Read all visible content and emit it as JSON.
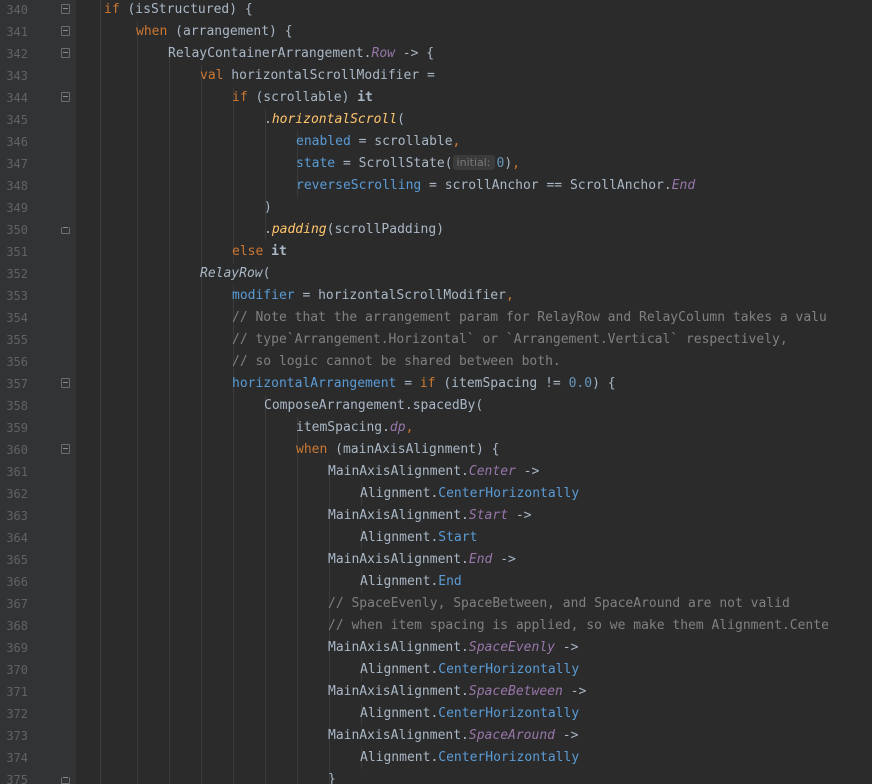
{
  "editor": {
    "lines": [
      {
        "n": "340",
        "indent": 1,
        "fold": "start",
        "tokens": [
          [
            "kw",
            "if"
          ],
          [
            "t",
            " (isStructured) {"
          ]
        ]
      },
      {
        "n": "341",
        "indent": 2,
        "fold": "start",
        "tokens": [
          [
            "kw",
            "when"
          ],
          [
            "t",
            " (arrangement) {"
          ]
        ]
      },
      {
        "n": "342",
        "indent": 3,
        "fold": "start",
        "tokens": [
          [
            "t",
            "RelayContainerArrangement."
          ],
          [
            "prop",
            "Row"
          ],
          [
            "t",
            " -> {"
          ]
        ]
      },
      {
        "n": "343",
        "indent": 4,
        "fold": "",
        "tokens": [
          [
            "kw",
            "val"
          ],
          [
            "t",
            " horizontalScrollModifier ="
          ]
        ]
      },
      {
        "n": "344",
        "indent": 5,
        "fold": "start",
        "tokens": [
          [
            "kw",
            "if"
          ],
          [
            "t",
            " (scrollable) "
          ],
          [
            "b",
            "it"
          ]
        ]
      },
      {
        "n": "345",
        "indent": 6,
        "fold": "",
        "tokens": [
          [
            "t",
            "."
          ],
          [
            "fn",
            "horizontalScroll"
          ],
          [
            "t",
            "("
          ]
        ]
      },
      {
        "n": "346",
        "indent": 7,
        "fold": "",
        "tokens": [
          [
            "param",
            "enabled"
          ],
          [
            "t",
            " = scrollable"
          ],
          [
            "punc",
            ","
          ]
        ]
      },
      {
        "n": "347",
        "indent": 7,
        "fold": "",
        "tokens": [
          [
            "param",
            "state"
          ],
          [
            "t",
            " = ScrollState("
          ],
          [
            "hint",
            "initial:"
          ],
          [
            "num",
            "0"
          ],
          [
            "t",
            ")"
          ],
          [
            "punc",
            ","
          ]
        ]
      },
      {
        "n": "348",
        "indent": 7,
        "fold": "",
        "tokens": [
          [
            "param",
            "reverseScrolling"
          ],
          [
            "t",
            " = scrollAnchor == ScrollAnchor."
          ],
          [
            "prop",
            "End"
          ]
        ]
      },
      {
        "n": "349",
        "indent": 6,
        "fold": "",
        "tokens": [
          [
            "t",
            ")"
          ]
        ]
      },
      {
        "n": "350",
        "indent": 6,
        "fold": "end",
        "tokens": [
          [
            "t",
            "."
          ],
          [
            "fn",
            "padding"
          ],
          [
            "t",
            "(scrollPadding)"
          ]
        ]
      },
      {
        "n": "351",
        "indent": 5,
        "fold": "",
        "tokens": [
          [
            "kw",
            "else"
          ],
          [
            "t",
            " "
          ],
          [
            "b",
            "it"
          ]
        ]
      },
      {
        "n": "352",
        "indent": 4,
        "fold": "",
        "tokens": [
          [
            "fi",
            "RelayRow"
          ],
          [
            "t",
            "("
          ]
        ]
      },
      {
        "n": "353",
        "indent": 5,
        "fold": "",
        "tokens": [
          [
            "param",
            "modifier"
          ],
          [
            "t",
            " = horizontalScrollModifier"
          ],
          [
            "punc",
            ","
          ]
        ]
      },
      {
        "n": "354",
        "indent": 5,
        "fold": "",
        "tokens": [
          [
            "cm",
            "// Note that the arrangement param for RelayRow and RelayColumn takes a valu"
          ]
        ]
      },
      {
        "n": "355",
        "indent": 5,
        "fold": "",
        "tokens": [
          [
            "cm",
            "// type`Arrangement.Horizontal` or `Arrangement.Vertical` respectively,"
          ]
        ]
      },
      {
        "n": "356",
        "indent": 5,
        "fold": "",
        "tokens": [
          [
            "cm",
            "// so logic cannot be shared between both."
          ]
        ]
      },
      {
        "n": "357",
        "indent": 5,
        "fold": "start",
        "tokens": [
          [
            "param",
            "horizontalArrangement"
          ],
          [
            "t",
            " = "
          ],
          [
            "kw",
            "if"
          ],
          [
            "t",
            " (itemSpacing != "
          ],
          [
            "num",
            "0.0"
          ],
          [
            "t",
            ") {"
          ]
        ]
      },
      {
        "n": "358",
        "indent": 6,
        "fold": "",
        "tokens": [
          [
            "t",
            "ComposeArrangement.spacedBy("
          ]
        ]
      },
      {
        "n": "359",
        "indent": 7,
        "fold": "",
        "tokens": [
          [
            "t",
            "itemSpacing."
          ],
          [
            "prop",
            "dp"
          ],
          [
            "punc",
            ","
          ]
        ]
      },
      {
        "n": "360",
        "indent": 7,
        "fold": "start",
        "tokens": [
          [
            "kw",
            "when"
          ],
          [
            "t",
            " (mainAxisAlignment) {"
          ]
        ]
      },
      {
        "n": "361",
        "indent": 8,
        "fold": "",
        "tokens": [
          [
            "t",
            "MainAxisAlignment."
          ],
          [
            "prop",
            "Center"
          ],
          [
            "t",
            " ->"
          ]
        ]
      },
      {
        "n": "362",
        "indent": 9,
        "fold": "",
        "tokens": [
          [
            "t",
            "Alignment."
          ],
          [
            "param",
            "CenterHorizontally"
          ]
        ]
      },
      {
        "n": "363",
        "indent": 8,
        "fold": "",
        "tokens": [
          [
            "t",
            "MainAxisAlignment."
          ],
          [
            "prop",
            "Start"
          ],
          [
            "t",
            " ->"
          ]
        ]
      },
      {
        "n": "364",
        "indent": 9,
        "fold": "",
        "tokens": [
          [
            "t",
            "Alignment."
          ],
          [
            "param",
            "Start"
          ]
        ]
      },
      {
        "n": "365",
        "indent": 8,
        "fold": "",
        "tokens": [
          [
            "t",
            "MainAxisAlignment."
          ],
          [
            "prop",
            "End"
          ],
          [
            "t",
            " ->"
          ]
        ]
      },
      {
        "n": "366",
        "indent": 9,
        "fold": "",
        "tokens": [
          [
            "t",
            "Alignment."
          ],
          [
            "param",
            "End"
          ]
        ]
      },
      {
        "n": "367",
        "indent": 8,
        "fold": "",
        "tokens": [
          [
            "cm",
            "// SpaceEvenly, SpaceBetween, and SpaceAround are not valid"
          ]
        ]
      },
      {
        "n": "368",
        "indent": 8,
        "fold": "",
        "tokens": [
          [
            "cm",
            "// when item spacing is applied, so we make them Alignment.Cente"
          ]
        ]
      },
      {
        "n": "369",
        "indent": 8,
        "fold": "",
        "tokens": [
          [
            "t",
            "MainAxisAlignment."
          ],
          [
            "prop",
            "SpaceEvenly"
          ],
          [
            "t",
            " ->"
          ]
        ]
      },
      {
        "n": "370",
        "indent": 9,
        "fold": "",
        "tokens": [
          [
            "t",
            "Alignment."
          ],
          [
            "param",
            "CenterHorizontally"
          ]
        ]
      },
      {
        "n": "371",
        "indent": 8,
        "fold": "",
        "tokens": [
          [
            "t",
            "MainAxisAlignment."
          ],
          [
            "prop",
            "SpaceBetween"
          ],
          [
            "t",
            " ->"
          ]
        ]
      },
      {
        "n": "372",
        "indent": 9,
        "fold": "",
        "tokens": [
          [
            "t",
            "Alignment."
          ],
          [
            "param",
            "CenterHorizontally"
          ]
        ]
      },
      {
        "n": "373",
        "indent": 8,
        "fold": "",
        "tokens": [
          [
            "t",
            "MainAxisAlignment."
          ],
          [
            "prop",
            "SpaceAround"
          ],
          [
            "t",
            " ->"
          ]
        ]
      },
      {
        "n": "374",
        "indent": 9,
        "fold": "",
        "tokens": [
          [
            "t",
            "Alignment."
          ],
          [
            "param",
            "CenterHorizontally"
          ]
        ]
      },
      {
        "n": "375",
        "indent": 8,
        "fold": "end",
        "tokens": [
          [
            "t",
            "}"
          ]
        ]
      }
    ]
  },
  "colors": {
    "background": "#2b2b2b",
    "gutter": "#313335",
    "keyword": "#cc7832",
    "function": "#ffc66d",
    "property": "#9876aa",
    "parameter": "#5a9bd5",
    "number": "#6897bb",
    "comment": "#808080",
    "text": "#a9b7c6"
  }
}
